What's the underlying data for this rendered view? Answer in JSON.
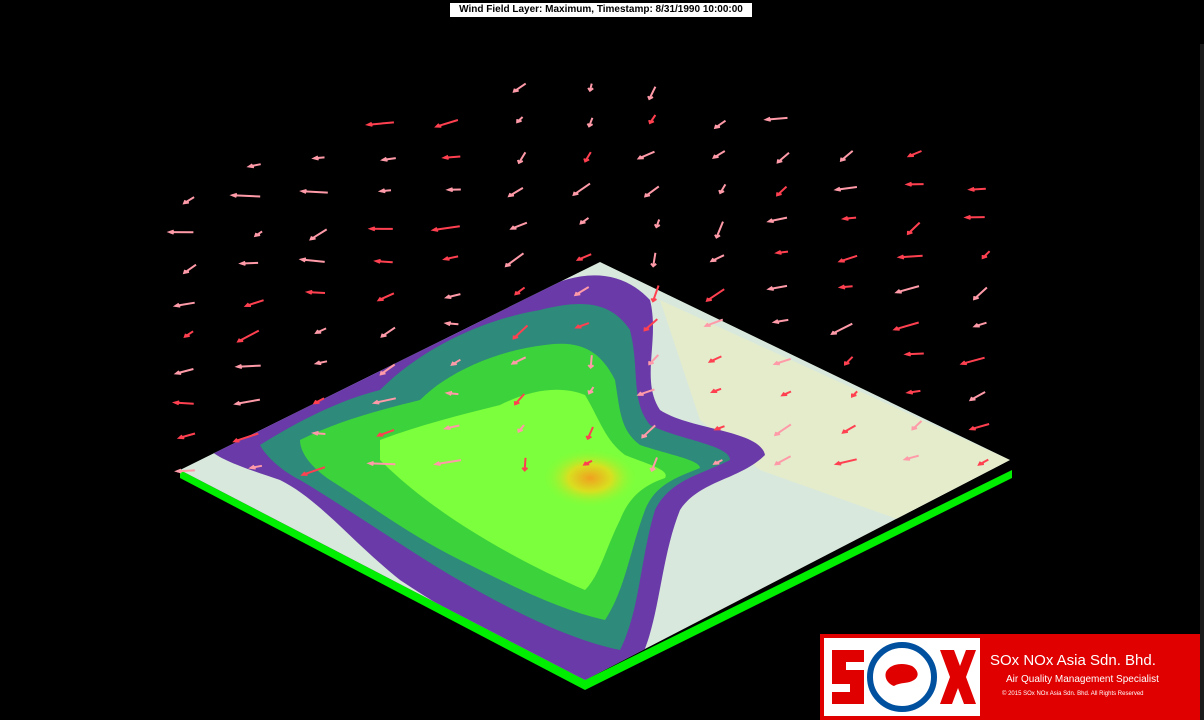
{
  "viewer": {
    "title": "Wind Field Layer: Maximum,  Timestamp: 8/31/1990 10:00:00"
  },
  "legend_colors": {
    "background": "#000000",
    "terrain_base": "#00ee00",
    "terrain_low": "#d8e8dc",
    "contour_purple": "#6a3aa8",
    "contour_teal": "#2e8a7a",
    "contour_green": "#3cd23c",
    "contour_lime": "#7cff3c",
    "contour_peak": "#e8a020",
    "wind_vector": "#ff9aa8",
    "wind_vector_strong": "#ff4050"
  },
  "logo": {
    "company_name": "SOx NOx Asia Sdn. Bhd.",
    "tagline": "Air Quality Management Specialist",
    "copyright": "© 2015 SOx NOx Asia Sdn. Bhd. All Rights Reserved",
    "brand_color": "#e00000"
  }
}
